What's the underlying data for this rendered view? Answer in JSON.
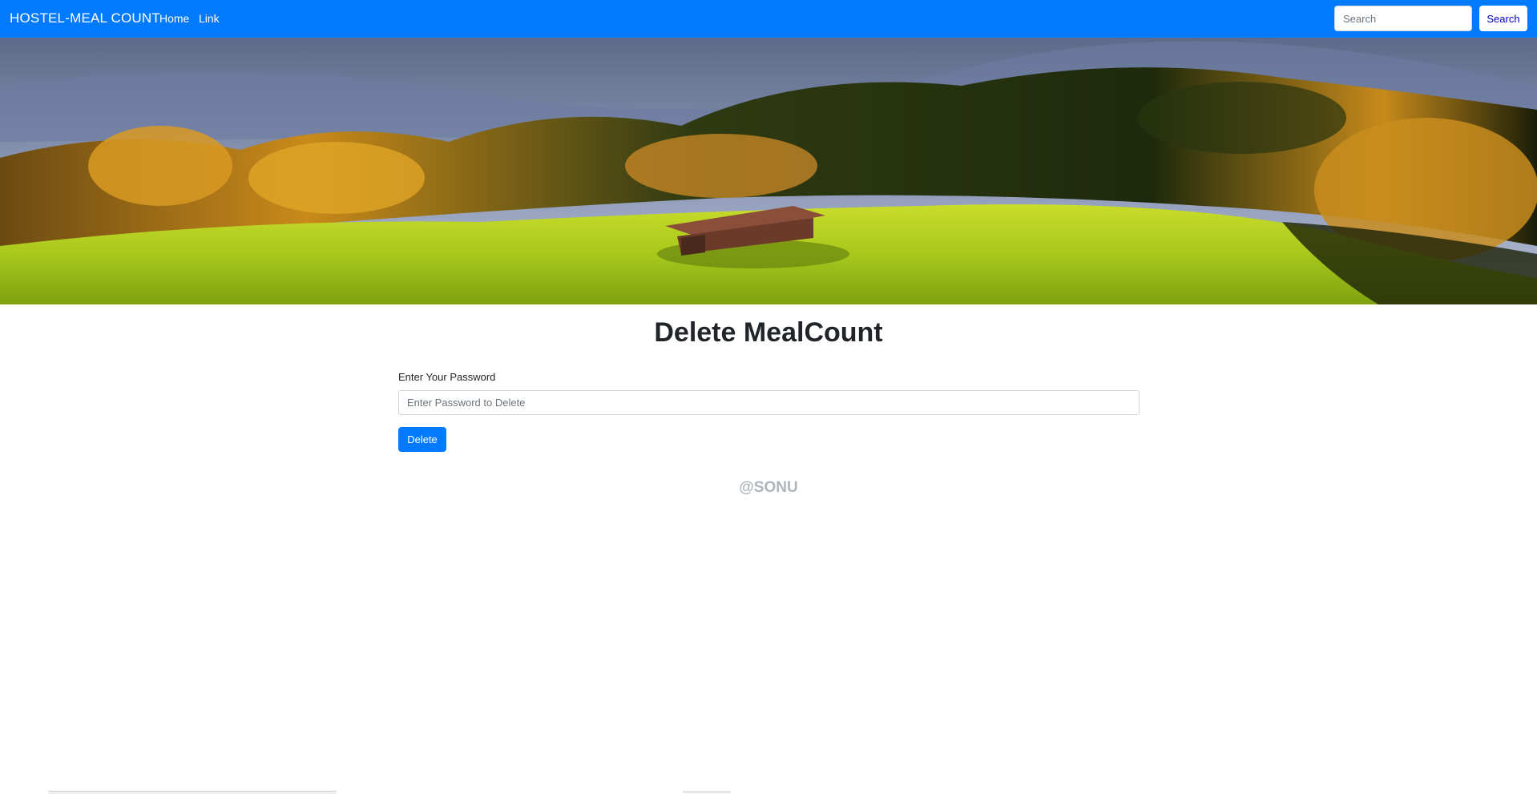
{
  "navbar": {
    "brand": "HOSTEL-MEAL COUNT",
    "links": [
      "Home",
      "Link"
    ],
    "search_placeholder": "Search",
    "search_button": "Search",
    "background_color": "#007bff"
  },
  "banner": {
    "icon": "landscape-image"
  },
  "main": {
    "title": "Delete MealCount",
    "password_label": "Enter Your Password",
    "password_placeholder": "Enter Password to Delete",
    "delete_button": "Delete",
    "accent_color": "#007bff"
  },
  "footer": {
    "credit": "@SONU"
  }
}
